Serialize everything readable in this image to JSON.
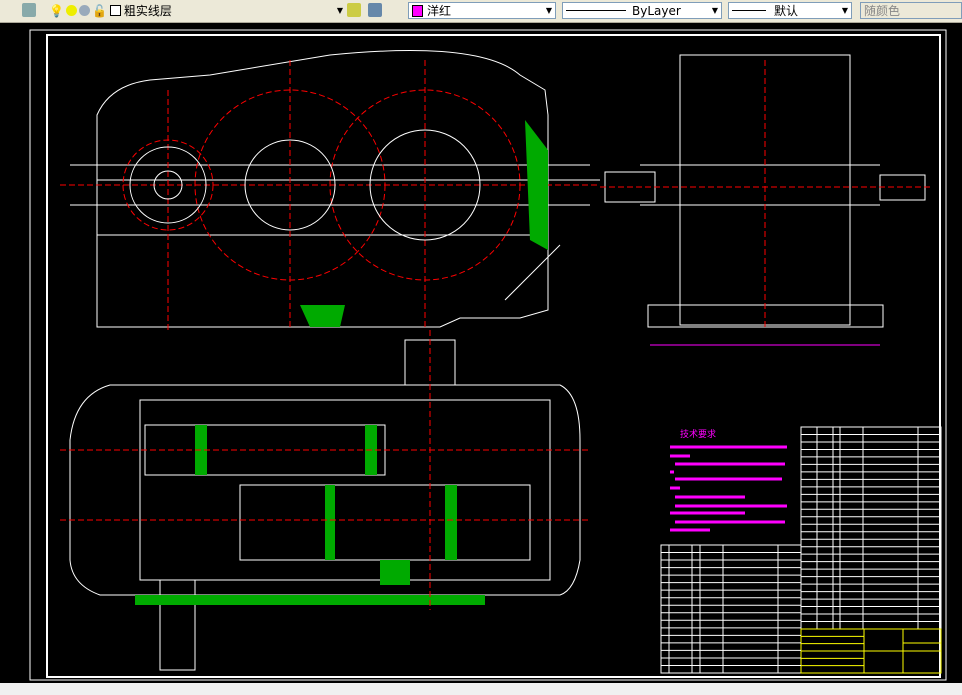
{
  "toolbar": {
    "layer": "粗实线层",
    "color": "洋红",
    "color_swatch": "#ff00ff",
    "linetype": "ByLayer",
    "lineweight": "默认",
    "plotstyle": "随颜色"
  },
  "drawing": {
    "notes_title": "技术要求",
    "colors": {
      "outline": "#ffffff",
      "centerline": "#ff0000",
      "hatch": "#00ff00",
      "notes": "#ff00ff",
      "titleblock": "#ffff00",
      "dimension": "#ff00ff"
    }
  }
}
